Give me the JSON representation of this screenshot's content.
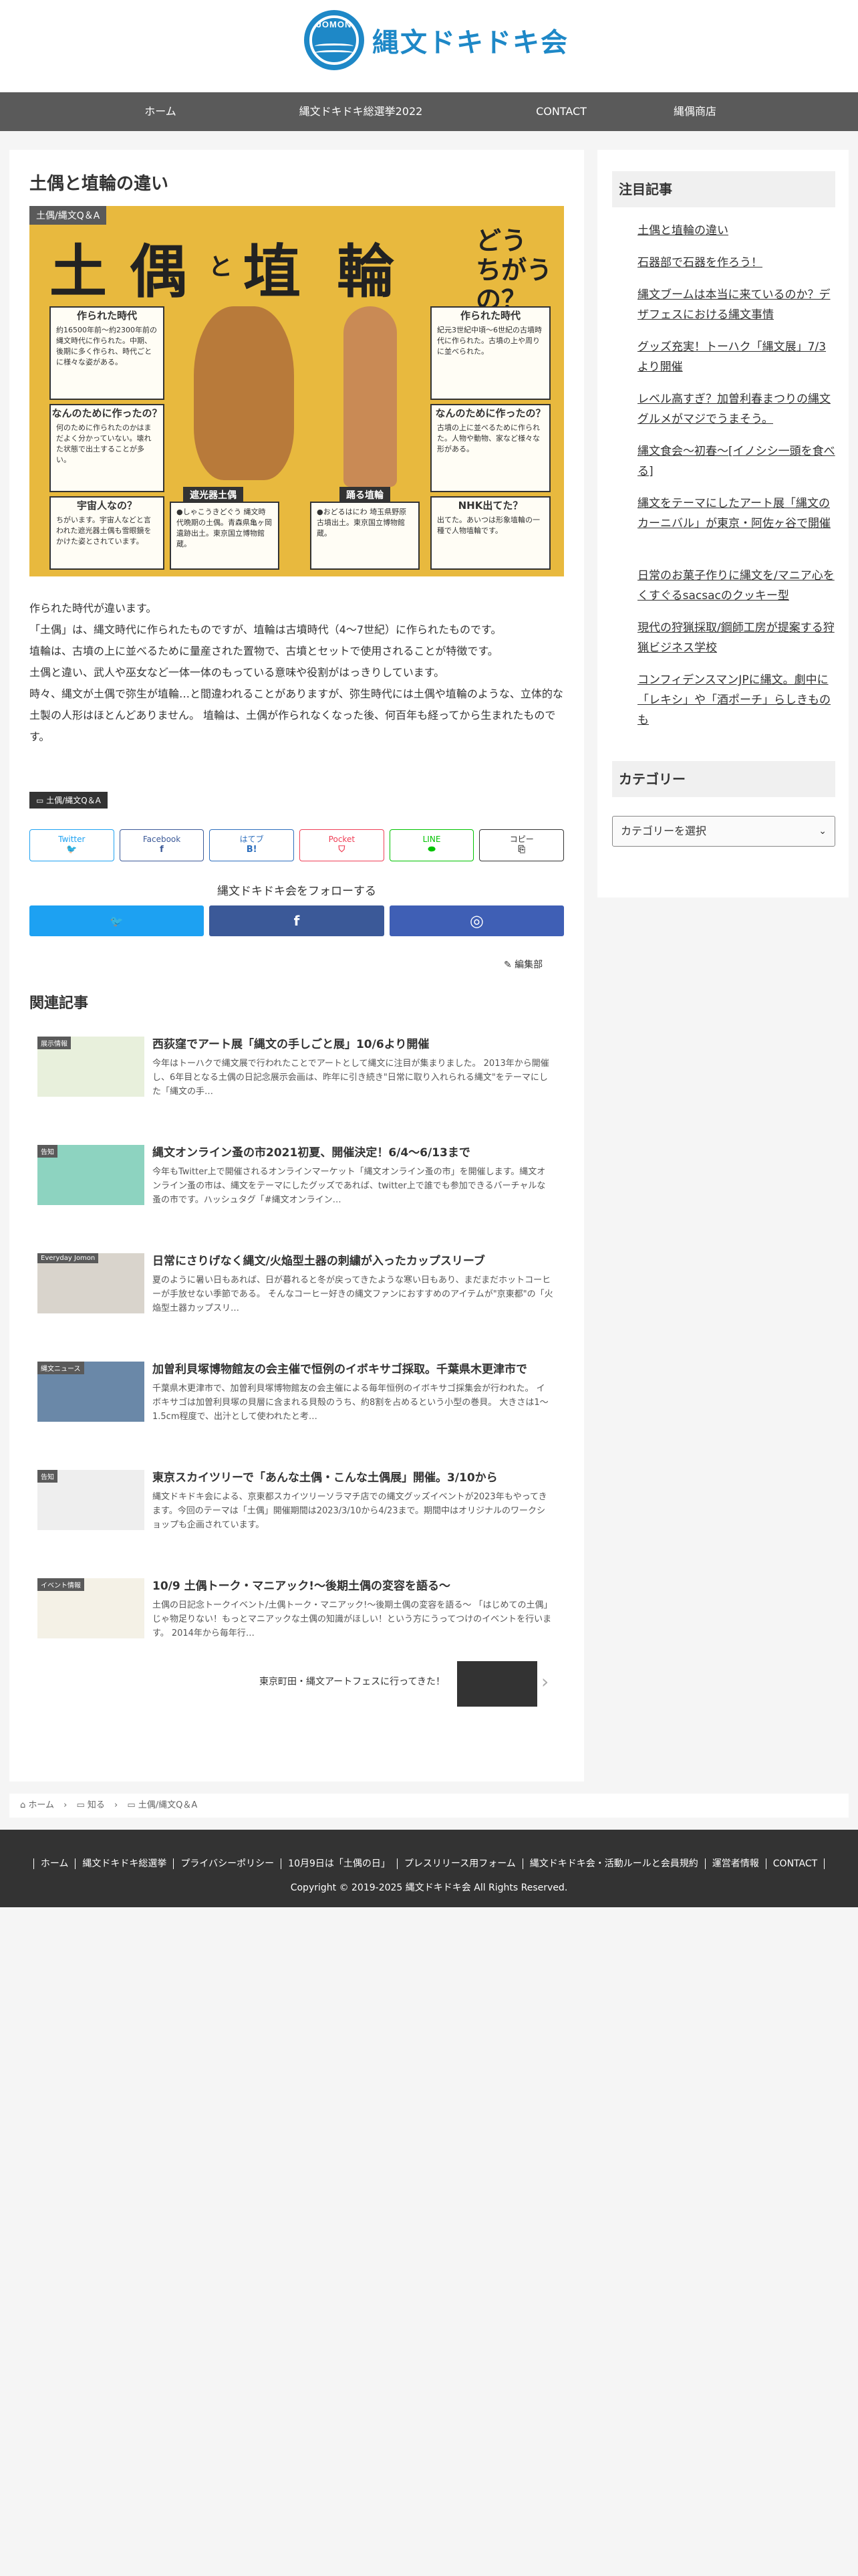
{
  "brand": {
    "logo_mark_text": "JOMON",
    "logo_text": "縄文ドキドキ会",
    "accent": "#1e88c7"
  },
  "nav": [
    "ホーム",
    "縄文ドキドキ総選挙2022",
    "10月9日は「土偶の日」",
    "CONTACT",
    "縄偶商店"
  ],
  "article": {
    "title": "土偶と埴輪の違い",
    "eyecatch": {
      "category": "土偶/縄文Q＆A",
      "big1": "土",
      "big2": "偶",
      "mid_to": "と",
      "big3": "埴",
      "big4": "輪",
      "question": "どう\nちがうの？",
      "left_box1_title": "作られた時代",
      "left_box1_text": "約16500年前〜約2300年前の縄文時代に作られた。中期、後期に多く作られ、時代ごとに様々な姿がある。",
      "left_box2_title": "なんのために作ったの？",
      "left_box2_text": "何のために作られたのかはまだよく分かっていない。壊れた状態で出土することが多い。",
      "left_box3_title": "宇宙人なの？",
      "left_box3_text": "ちがいます。宇宙人などと言われた遮光器土偶も雪眼鏡をかけた姿とされています。",
      "right_box1_title": "作られた時代",
      "right_box1_text": "紀元3世紀中頃〜6世紀の古墳時代に作られた。古墳の上や周りに並べられた。",
      "right_box2_title": "なんのために作ったの？",
      "right_box2_text": "古墳の上に並べるために作られた。人物や動物、家など様々な形がある。",
      "right_box3_title": "NHK出てた？",
      "right_box3_text": "出てた。あいつは形象埴輪の一種で人物埴輪です。",
      "tab_left": "遮光器土偶",
      "tab_right": "踊る埴輪",
      "mid_box_left": "●しゃこうきどぐう 縄文時代晩期の土偶。青森県亀ヶ岡遺跡出土。東京国立博物館蔵。",
      "mid_box_right": "●おどるはにわ 埼玉県野原古墳出土。東京国立博物館蔵。"
    },
    "paragraphs": [
      "作られた時代が違います。",
      "「土偶」は、縄文時代に作られたものですが、埴輪は古墳時代（4〜7世紀）に作られたものです。",
      "埴輪は、古墳の上に並べるために量産された置物で、古墳とセットで使用されることが特徴です。",
      "土偶と違い、武人や巫女など一体一体のもっている意味や役割がはっきりしています。",
      "時々、縄文が土偶で弥生が埴輪…と間違われることがありますが、弥生時代には土偶や埴輪のような、立体的な土製の人形はほとんどありません。 埴輪は、土偶が作られなくなった後、何百年も経ってから生まれたものです。"
    ],
    "tag": "土偶/縄文Q＆A"
  },
  "share": [
    {
      "label": "Twitter",
      "icon": "twitter-icon",
      "glyph": "🐦",
      "color": "#1da1f2"
    },
    {
      "label": "Facebook",
      "icon": "facebook-icon",
      "glyph": "f",
      "color": "#3b5998"
    },
    {
      "label": "はてブ",
      "icon": "hatena-icon",
      "glyph": "B!",
      "color": "#2c6ebd"
    },
    {
      "label": "Pocket",
      "icon": "pocket-icon",
      "glyph": "⛉",
      "color": "#ef3f56"
    },
    {
      "label": "LINE",
      "icon": "line-icon",
      "glyph": "⬬",
      "color": "#00c300"
    },
    {
      "label": "コピー",
      "icon": "copy-icon",
      "glyph": "⎘",
      "color": "#333333"
    }
  ],
  "follow": {
    "title": "縄文ドキドキ会をフォローする",
    "buttons": [
      {
        "icon": "twitter-icon",
        "glyph": "🐦",
        "color": "#1da1f2"
      },
      {
        "icon": "facebook-icon",
        "glyph": "f",
        "color": "#3b5998"
      },
      {
        "icon": "instagram-icon",
        "glyph": "◎",
        "color": "#3f5fb5"
      }
    ]
  },
  "edit_label": "✎ 編集部",
  "related": {
    "heading": "関連記事",
    "items": [
      {
        "title": "西荻窪でアート展「縄文の手しごと展」10/6より開催",
        "snippet": "今年はトーハクで縄文展で行われたことでアートとして縄文に注目が集まりました。 2013年から開催し、6年目となる土偶の日記念展示会画は、昨年に引き続き\"日常に取り入れられる縄文\"をテーマにした「縄文の手…",
        "cat": "展示情報",
        "thumb_color": "#e8f0dc"
      },
      {
        "title": "縄文オンライン蚤の市2021初夏、開催決定！6/4〜6/13まで",
        "snippet": "今年もTwitter上で開催されるオンラインマーケット「縄文オンライン蚤の市」を開催します。縄文オンライン蚤の市は、縄文をテーマにしたグッズであれば、twitter上で誰でも参加できるバーチャルな蚤の市です。ハッシュタグ「#縄文オンライン…",
        "cat": "告知",
        "thumb_color": "#8dd3c0"
      },
      {
        "title": "日常にさりげなく縄文/火焔型土器の刺繍が入ったカップスリーブ",
        "snippet": "夏のように暑い日もあれば、日が暮れると冬が戻ってきたような寒い日もあり、まだまだホットコーヒーが手放せない季節である。 そんなコーヒー好きの縄文ファンにおすすめのアイテムが\"京東都\"の「火焔型土器カップスリ…",
        "cat": "Everyday Jomon",
        "thumb_color": "#d9d4cc"
      },
      {
        "title": "加曽利貝塚博物館友の会主催で恒例のイボキサゴ採取。千葉県木更津市で",
        "snippet": " 千葉県木更津市で、加曽利貝塚博物館友の会主催による毎年恒例のイボキサゴ採集会が行われた。 イボキサゴは加曽利貝塚の貝層に含まれる貝殻のうち、約8割を占めるという小型の巻貝。 大きさは1〜1.5cm程度で、出汁として使われたと考…",
        "cat": "縄文ニュース",
        "thumb_color": "#6a88a8"
      },
      {
        "title": "東京スカイツリーで「あんな土偶・こんな土偶展」開催。3/10から",
        "snippet": "縄文ドキドキ会による、京東都スカイツリーソラマチ店での縄文グッズイベントが2023年もやってきます。今回のテーマは「土偶」開催期間は2023/3/10から4/23まで。期間中はオリジナルのワークショップも企画されています。",
        "cat": "告知",
        "thumb_color": "#eeeeee"
      },
      {
        "title": "10/9 土偶トーク・マニアック!〜後期土偶の変容を語る〜",
        "snippet": "土偶の日記念トークイベント/土偶トーク・マニアック!〜後期土偶の変容を語る〜 「はじめての土偶」じゃ物足りない！もっとマニアックな土偶の知識がほしい！という方にうってつけのイベントを行います。 2014年から毎年行…",
        "cat": "イベント情報",
        "thumb_color": "#f4f1e6"
      }
    ]
  },
  "prev_post": "東京町田・縄文アートフェスに行ってきた！",
  "sidebar": {
    "recent_heading": "注目記事",
    "recent": [
      "土偶と埴輪の違い",
      "石器部で石器を作ろう！",
      "縄文ブームは本当に来ているのか？デザフェスにおける縄文事情",
      "グッズ充実！トーハク「縄文展」7/3より開催",
      "レベル高すぎ？加曽利春まつりの縄文グルメがマジでうまそう。",
      "縄文食会〜初春〜[イノシシ一頭を食べる]",
      "縄文をテーマにしたアート展「縄文のカーニバル」が東京・阿佐ヶ谷で開催",
      "日常のお菓子作りに縄文を/マニア心をくすぐるsacsacのクッキー型",
      "現代の狩猟採取/鋼師工房が提案する狩猟ビジネス学校",
      "コンフィデンスマンJPに縄文。劇中に「レキシ」や「酒ポーチ」らしきものも"
    ],
    "category_heading": "カテゴリー",
    "category_select": "カテゴリーを選択"
  },
  "breadcrumb": [
    "⌂ ホーム",
    "›",
    "▭ 知る",
    "›",
    "▭ 土偶/縄文Q＆A"
  ],
  "footer": {
    "links": [
      "ホーム",
      "縄文ドキドキ総選挙",
      "プライバシーポリシー",
      "10月9日は「土偶の日」",
      "プレスリリース用フォーム",
      "縄文ドキドキ会・活動ルールと会員規約",
      "運営者情報",
      "CONTACT"
    ],
    "copyright": "Copyright © 2019-2025 縄文ドキドキ会 All Rights Reserved."
  }
}
